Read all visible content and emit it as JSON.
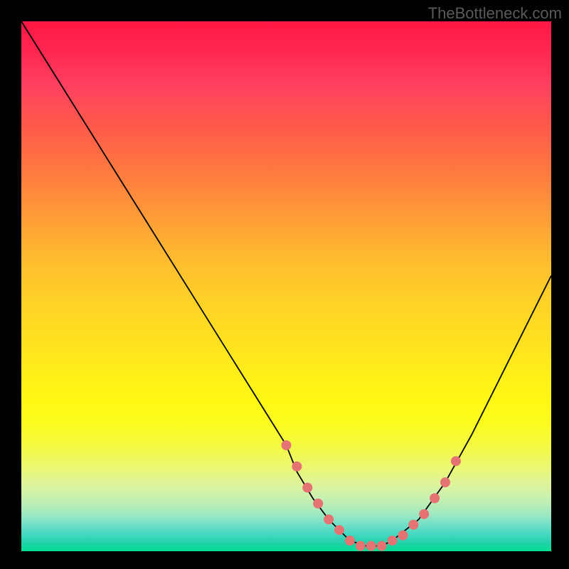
{
  "watermark": "TheBottleneck.com",
  "chart_data": {
    "type": "line",
    "title": "",
    "xlabel": "",
    "ylabel": "",
    "xlim": [
      0,
      100
    ],
    "ylim": [
      0,
      100
    ],
    "curve": {
      "name": "bottleneck-curve",
      "x": [
        0,
        5,
        10,
        15,
        20,
        25,
        30,
        35,
        40,
        45,
        50,
        52,
        55,
        58,
        60,
        62,
        65,
        68,
        70,
        75,
        80,
        85,
        90,
        95,
        100
      ],
      "y": [
        100,
        92,
        84,
        76,
        68,
        60,
        52,
        44,
        36,
        28,
        20,
        15,
        10,
        6,
        4,
        2,
        1,
        1,
        2,
        6,
        13,
        22,
        32,
        42,
        52
      ]
    },
    "markers": {
      "name": "highlight-points",
      "color": "#e57373",
      "x": [
        50,
        52,
        54,
        56,
        58,
        60,
        62,
        64,
        66,
        68,
        70,
        72,
        74,
        76,
        78,
        80,
        82
      ],
      "y": [
        20,
        16,
        12,
        9,
        6,
        4,
        2,
        1,
        1,
        1,
        2,
        3,
        5,
        7,
        10,
        13,
        17
      ]
    },
    "annotations": []
  }
}
